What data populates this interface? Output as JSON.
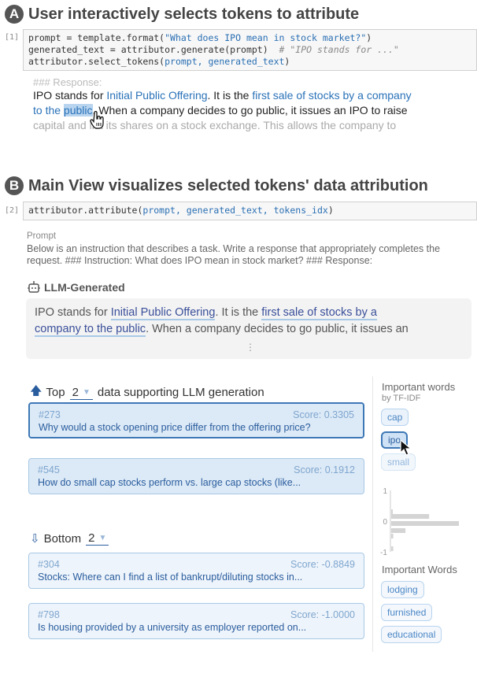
{
  "section_a": {
    "badge": "A",
    "title": "User interactively selects tokens to attribute",
    "cell_number": "[1]",
    "code_lines": [
      {
        "parts": [
          {
            "t": "prompt = template.format(",
            "c": ""
          },
          {
            "t": "\"What does IPO mean in stock market?\"",
            "c": "blue"
          },
          {
            "t": ")",
            "c": ""
          }
        ]
      },
      {
        "parts": [
          {
            "t": "generated_text = attributor.generate(prompt)  ",
            "c": ""
          },
          {
            "t": "# \"IPO stands for ...\"",
            "c": "cmt"
          }
        ]
      },
      {
        "parts": [
          {
            "t": "attributor.select_tokens(",
            "c": ""
          },
          {
            "t": "prompt, generated_text",
            "c": "blue"
          },
          {
            "t": ")",
            "c": ""
          }
        ]
      }
    ],
    "response_header": "### Response:",
    "response_line1": [
      {
        "t": "IPO stands for ",
        "c": ""
      },
      {
        "t": "Initial Public Offering",
        "c": "hl-blue"
      },
      {
        "t": ". It is the ",
        "c": ""
      },
      {
        "t": "first sale of stocks by a company",
        "c": "hl-blue"
      }
    ],
    "response_line2": [
      {
        "t": "to the ",
        "c": "hl-blue"
      },
      {
        "t": "public",
        "c": "sel"
      },
      {
        "t": ". When a company decides to go public, it issues an IPO to raise",
        "c": ""
      }
    ],
    "response_line3": "capital and list its shares on a stock exchange. This allows the company to"
  },
  "section_b": {
    "badge": "B",
    "title": "Main View visualizes selected tokens' data attribution",
    "cell_number": "[2]",
    "code_lines": [
      {
        "parts": [
          {
            "t": "attributor.attribute(",
            "c": ""
          },
          {
            "t": "prompt, generated_text, tokens_idx",
            "c": "blue"
          },
          {
            "t": ")",
            "c": ""
          }
        ]
      }
    ],
    "prompt_label": "Prompt",
    "prompt_text": "Below is an instruction that describes a task. Write a response that appropriately completes the request. ### Instruction: What does IPO mean in stock market? ### Response:",
    "generated_label": "LLM-Generated",
    "generated_line1": [
      {
        "t": "IPO stands for ",
        "c": ""
      },
      {
        "t": "Initial Public Offering",
        "c": "ul"
      },
      {
        "t": ". It is the ",
        "c": ""
      },
      {
        "t": "first sale of stocks by a",
        "c": "ul"
      }
    ],
    "generated_line2": [
      {
        "t": "company to the public",
        "c": "ul"
      },
      {
        "t": ". When a company decides to go public, it issues an",
        "c": ""
      }
    ],
    "more_indicator": "⋮",
    "top": {
      "label_pre": "Top",
      "count": "2",
      "label_post": "data supporting LLM generation",
      "items": [
        {
          "id": "#273",
          "score": "Score: 0.3305",
          "text": "Why would a stock opening price differ from the offering price?"
        },
        {
          "id": "#545",
          "score": "Score: 0.1912",
          "text": "How do small cap stocks perform vs. large cap stocks (like..."
        }
      ]
    },
    "bottom": {
      "label_pre": "Bottom",
      "count": "2",
      "items": [
        {
          "id": "#304",
          "score": "Score: -0.8849",
          "text": "Stocks: Where can I find a list of bankrupt/diluting stocks in..."
        },
        {
          "id": "#798",
          "score": "Score: -1.0000",
          "text": "Is housing provided by a university as employer reported on..."
        }
      ]
    },
    "sidebar": {
      "top_title": "Important words",
      "top_subtitle": "by TF-IDF",
      "top_words": [
        "cap",
        "ipo",
        "small"
      ],
      "selected_word": "ipo",
      "histogram": {
        "axis_ticks": [
          "1",
          "0",
          "-1"
        ],
        "bins": [
          0.02,
          0.56,
          1.0,
          0.21,
          0.03,
          0.03
        ]
      },
      "bottom_title": "Important Words",
      "bottom_words": [
        "lodging",
        "furnished",
        "educational"
      ]
    }
  }
}
